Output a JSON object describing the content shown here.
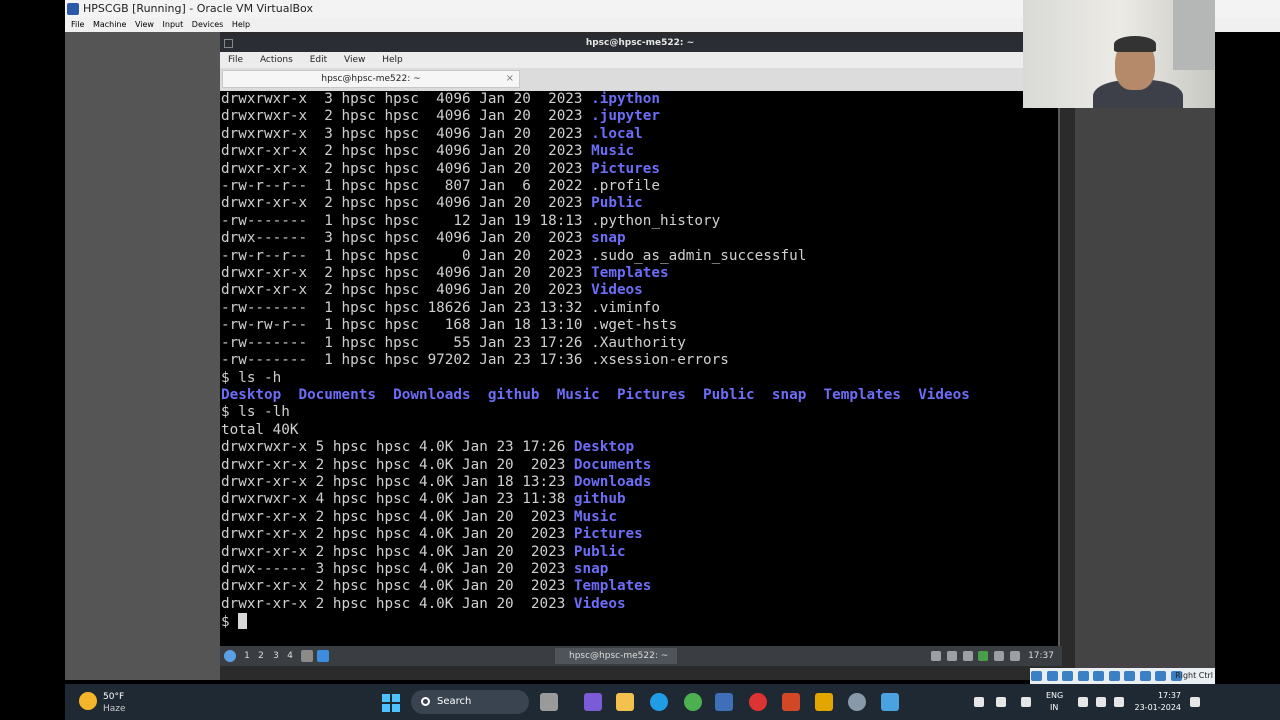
{
  "vbox": {
    "title": "HPSCGB [Running] - Oracle VM VirtualBox",
    "menu": [
      "File",
      "Machine",
      "View",
      "Input",
      "Devices",
      "Help"
    ]
  },
  "terminal": {
    "title": "hpsc@hpsc-me522: ~",
    "menu": [
      "File",
      "Actions",
      "Edit",
      "View",
      "Help"
    ],
    "tab_label": "hpsc@hpsc-me522: ~",
    "tab_close": "×",
    "lines": [
      {
        "text": "drwxrwxr-x  3 hpsc hpsc  4096 Jan 20  2023 ",
        "name": ".ipython",
        "dir": true
      },
      {
        "text": "drwxrwxr-x  2 hpsc hpsc  4096 Jan 20  2023 ",
        "name": ".jupyter",
        "dir": true
      },
      {
        "text": "drwxrwxr-x  3 hpsc hpsc  4096 Jan 20  2023 ",
        "name": ".local",
        "dir": true
      },
      {
        "text": "drwxr-xr-x  2 hpsc hpsc  4096 Jan 20  2023 ",
        "name": "Music",
        "dir": true
      },
      {
        "text": "drwxr-xr-x  2 hpsc hpsc  4096 Jan 20  2023 ",
        "name": "Pictures",
        "dir": true
      },
      {
        "text": "-rw-r--r--  1 hpsc hpsc   807 Jan  6  2022 ",
        "name": ".profile",
        "dir": false
      },
      {
        "text": "drwxr-xr-x  2 hpsc hpsc  4096 Jan 20  2023 ",
        "name": "Public",
        "dir": true
      },
      {
        "text": "-rw-------  1 hpsc hpsc    12 Jan 19 18:13 ",
        "name": ".python_history",
        "dir": false
      },
      {
        "text": "drwx------  3 hpsc hpsc  4096 Jan 20  2023 ",
        "name": "snap",
        "dir": true
      },
      {
        "text": "-rw-r--r--  1 hpsc hpsc     0 Jan 20  2023 ",
        "name": ".sudo_as_admin_successful",
        "dir": false
      },
      {
        "text": "drwxr-xr-x  2 hpsc hpsc  4096 Jan 20  2023 ",
        "name": "Templates",
        "dir": true
      },
      {
        "text": "drwxr-xr-x  2 hpsc hpsc  4096 Jan 20  2023 ",
        "name": "Videos",
        "dir": true
      },
      {
        "text": "-rw-------  1 hpsc hpsc 18626 Jan 23 13:32 ",
        "name": ".viminfo",
        "dir": false
      },
      {
        "text": "-rw-rw-r--  1 hpsc hpsc   168 Jan 18 13:10 ",
        "name": ".wget-hsts",
        "dir": false
      },
      {
        "text": "-rw-------  1 hpsc hpsc    55 Jan 23 17:26 ",
        "name": ".Xauthority",
        "dir": false
      },
      {
        "text": "-rw-------  1 hpsc hpsc 97202 Jan 23 17:36 ",
        "name": ".xsession-errors",
        "dir": false
      },
      {
        "text": "$ ls -h",
        "name": "",
        "dir": false
      },
      {
        "text": "",
        "name": "Desktop  Documents  Downloads  github  Music  Pictures  Public  snap  Templates  Videos",
        "dir": true
      },
      {
        "text": "$ ls -lh",
        "name": "",
        "dir": false
      },
      {
        "text": "total 40K",
        "name": "",
        "dir": false
      },
      {
        "text": "drwxrwxr-x 5 hpsc hpsc 4.0K Jan 23 17:26 ",
        "name": "Desktop",
        "dir": true
      },
      {
        "text": "drwxr-xr-x 2 hpsc hpsc 4.0K Jan 20  2023 ",
        "name": "Documents",
        "dir": true
      },
      {
        "text": "drwxr-xr-x 2 hpsc hpsc 4.0K Jan 18 13:23 ",
        "name": "Downloads",
        "dir": true
      },
      {
        "text": "drwxrwxr-x 4 hpsc hpsc 4.0K Jan 23 11:38 ",
        "name": "github",
        "dir": true
      },
      {
        "text": "drwxr-xr-x 2 hpsc hpsc 4.0K Jan 20  2023 ",
        "name": "Music",
        "dir": true
      },
      {
        "text": "drwxr-xr-x 2 hpsc hpsc 4.0K Jan 20  2023 ",
        "name": "Pictures",
        "dir": true
      },
      {
        "text": "drwxr-xr-x 2 hpsc hpsc 4.0K Jan 20  2023 ",
        "name": "Public",
        "dir": true
      },
      {
        "text": "drwx------ 3 hpsc hpsc 4.0K Jan 20  2023 ",
        "name": "snap",
        "dir": true
      },
      {
        "text": "drwxr-xr-x 2 hpsc hpsc 4.0K Jan 20  2023 ",
        "name": "Templates",
        "dir": true
      },
      {
        "text": "drwxr-xr-x 2 hpsc hpsc 4.0K Jan 20  2023 ",
        "name": "Videos",
        "dir": true
      }
    ],
    "prompt": "$ ",
    "dir_color": "#6d6df7"
  },
  "xfce_panel": {
    "workspaces": [
      "1",
      "2",
      "3",
      "4"
    ],
    "task_label": "hpsc@hpsc-me522: ~",
    "clock": "17:37"
  },
  "vbox_status": {
    "host_key": "Right Ctrl"
  },
  "windows_taskbar": {
    "weather_temp": "50°F",
    "weather_cond": "Haze",
    "search_label": "Search",
    "lang_line1": "ENG",
    "lang_line2": "IN",
    "time": "17:37",
    "date": "23-01-2024",
    "pinned_icons": [
      "butterfly-icon",
      "copilot-icon",
      "file-explorer-icon",
      "edge-icon",
      "chrome-icon",
      "virtualbox-icon",
      "recorder-icon",
      "powerpoint-icon",
      "paint-icon",
      "settings-icon",
      "notepad-icon"
    ]
  }
}
